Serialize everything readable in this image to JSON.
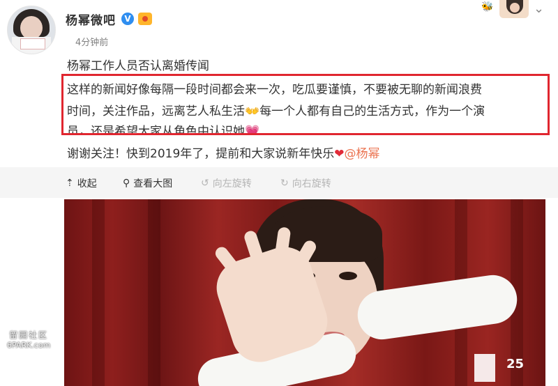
{
  "post": {
    "author": "杨幂微吧",
    "time": "4分钟前",
    "lines": [
      "杨幂工作人员否认离婚传闻",
      "这样的新闻好像每隔一段时间都会来一次，吃瓜要谨慎，不要被无聊的新闻浪费",
      "时间，关注作品，远离艺人私生活",
      "每一个人都有自己的生活方式，作为一个演",
      "员，还是希望大家从角色中认识她",
      "谢谢关注！快到2019年了，提前和大家说新年快乐",
      "@杨幂"
    ]
  },
  "toolbar": {
    "collapse": "收起",
    "view_large": "查看大图",
    "rotate_left": "向左旋转",
    "rotate_right": "向右旋转"
  },
  "icons": {
    "verified": "verified-v-icon",
    "level": "level-badge-icon",
    "clap": "clap-emoji",
    "heart": "heart-emoji",
    "chevron": "chevron-down-icon"
  },
  "photo": {
    "logo_number": "25"
  },
  "watermark": {
    "line1": "留园社区",
    "line2": "6PARK.com"
  },
  "colors": {
    "highlight": "#e0262f",
    "mention": "#eb7350",
    "verified": "#2f8ef0"
  }
}
